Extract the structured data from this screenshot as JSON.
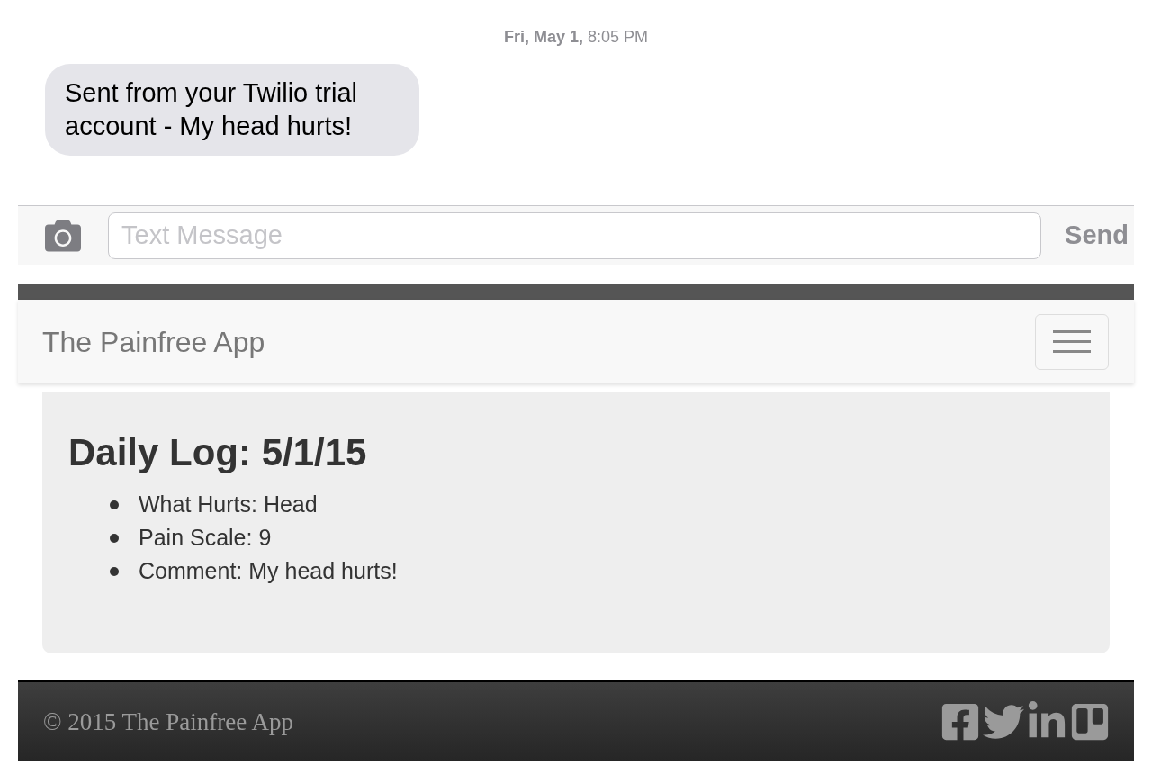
{
  "messages": {
    "timestamp": "**Fri, May 1,** 8:05 PM",
    "bubbles": [
      "Sent from your Twilio trial account - My head hurts!"
    ],
    "input": {
      "placeholder": "Text Message"
    },
    "send_button": "Send"
  },
  "navbar": {
    "brand": "The Painfree App"
  },
  "log": {
    "title": "Daily Log: 5/1/15",
    "items": [
      "What Hurts: Head",
      "Pain Scale: 9",
      "Comment: My head hurts!"
    ]
  },
  "footer": {
    "copyright": "© 2015 The Painfree App",
    "social": [
      {
        "kind": "facebook"
      },
      {
        "kind": "twitter"
      },
      {
        "kind": "linkedin"
      },
      {
        "kind": "trello"
      }
    ]
  }
}
